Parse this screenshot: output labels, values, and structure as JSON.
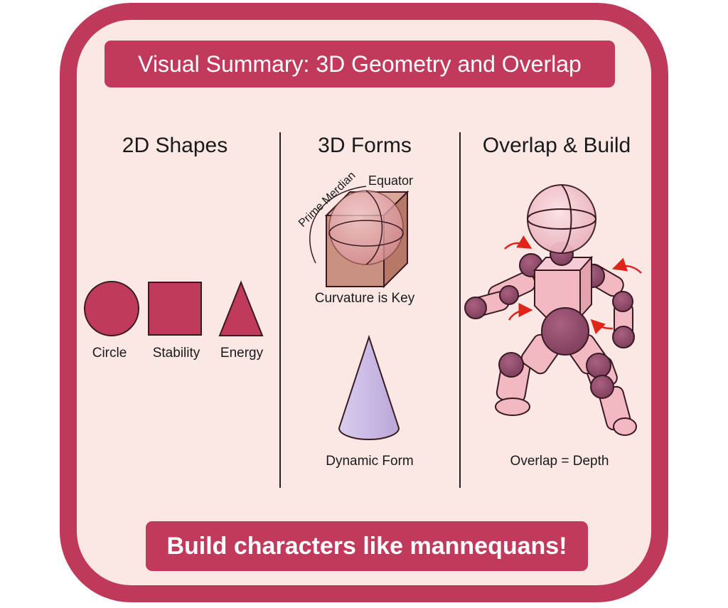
{
  "title": "Visual Summary: 3D Geometry and Overlap",
  "columns": [
    {
      "heading": "2D Shapes",
      "labels": [
        "Circle",
        "Stability",
        "Energy"
      ]
    },
    {
      "heading": "3D Forms",
      "cube_labels": {
        "prime_meridian": "Prime Merdian",
        "equator": "Equator"
      },
      "caption_top": "Curvature is Key",
      "caption_bottom": "Dynamic Form"
    },
    {
      "heading": "Overlap & Build",
      "caption": "Overlap = Depth"
    }
  ],
  "footer": "Build characters like mannequans!",
  "colors": {
    "frame": "#bf3a5a",
    "background": "#fbe8e5",
    "shape_fill": "#c03a5b",
    "joint": "#8a4a6a",
    "cone": "#c9b8e0",
    "arrow": "#e0241a"
  }
}
